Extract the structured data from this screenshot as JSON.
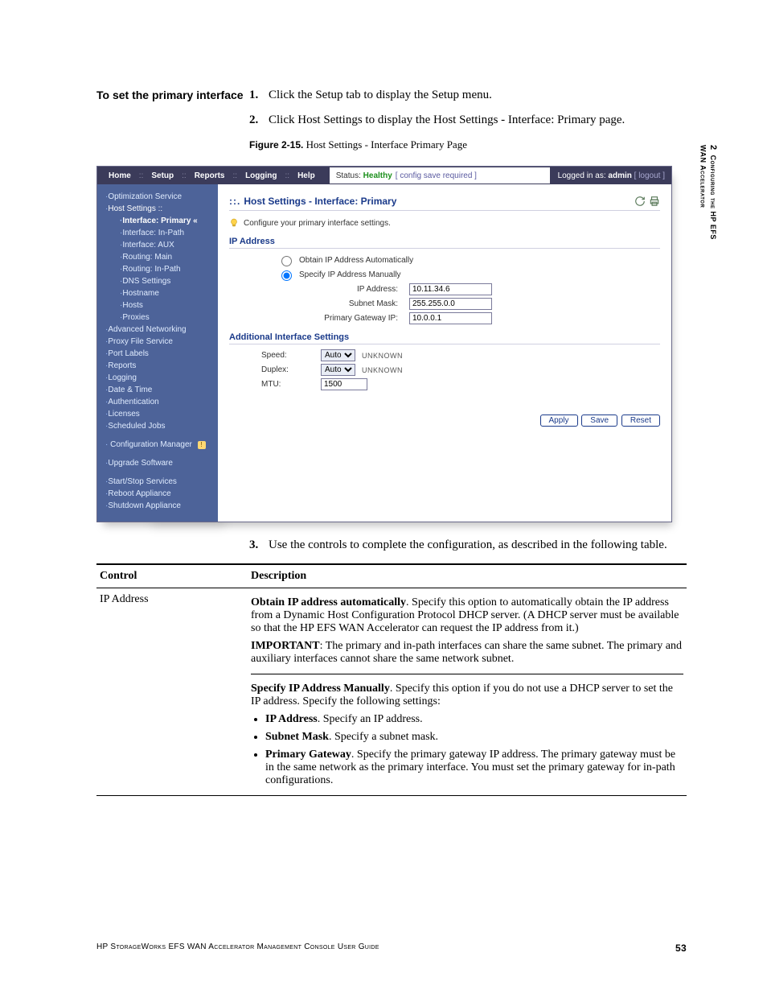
{
  "side": {
    "chapnum": "2",
    "chaptext_l1": "Configuring the HP EFS",
    "chaptext_l2": "WAN Accelerator"
  },
  "heading_left": "To set the primary interface",
  "steps": {
    "s1": "Click the Setup tab to display the Setup menu.",
    "s2": "Click Host Settings to display the Host Settings - Interface: Primary page.",
    "s3": "Use the controls to complete the configuration, as described in the following table."
  },
  "fig": {
    "label": "Figure 2-15.",
    "title": "Host Settings - Interface Primary Page"
  },
  "topbar": {
    "tab_home": "Home",
    "tab_setup": "Setup",
    "tab_reports": "Reports",
    "tab_logging": "Logging",
    "tab_help": "Help",
    "status_label": "Status:",
    "status_value": "Healthy",
    "status_note": "[ config save required ]",
    "login_prefix": "Logged in as:",
    "login_user": "admin",
    "logout": "[ logout ]"
  },
  "sidebar": {
    "opt_service": "Optimization Service",
    "host_settings": "Host Settings ::",
    "if_primary": "Interface: Primary",
    "if_inpath": "Interface: In-Path",
    "if_aux": "Interface: AUX",
    "rt_main": "Routing: Main",
    "rt_inpath": "Routing: In-Path",
    "dns": "DNS Settings",
    "hostname": "Hostname",
    "hosts": "Hosts",
    "proxies": "Proxies",
    "adv_net": "Advanced Networking",
    "proxy_fs": "Proxy File Service",
    "port_labels": "Port Labels",
    "reports": "Reports",
    "logging": "Logging",
    "datetime": "Date & Time",
    "auth": "Authentication",
    "licenses": "Licenses",
    "sched": "Scheduled Jobs",
    "cfgmgr": "Configuration Manager",
    "upgrade": "Upgrade Software",
    "startstop": "Start/Stop Services",
    "reboot": "Reboot Appliance",
    "shutdown": "Shutdown Appliance"
  },
  "main": {
    "title": "Host Settings - Interface: Primary",
    "hint": "Configure your primary interface settings.",
    "sect_ip": "IP Address",
    "radio_auto": "Obtain IP Address Automatically",
    "radio_manual": "Specify IP Address Manually",
    "lbl_ip": "IP Address:",
    "lbl_subnet": "Subnet Mask:",
    "lbl_gw": "Primary Gateway IP:",
    "val_ip": "10.11.34.6",
    "val_subnet": "255.255.0.0",
    "val_gw": "10.0.0.1",
    "sect_addl": "Additional Interface Settings",
    "lbl_speed": "Speed:",
    "val_speed": "Auto",
    "after_speed": "UNKNOWN",
    "lbl_duplex": "Duplex:",
    "val_duplex": "Auto",
    "after_duplex": "UNKNOWN",
    "lbl_mtu": "MTU:",
    "val_mtu": "1500",
    "btn_apply": "Apply",
    "btn_save": "Save",
    "btn_reset": "Reset"
  },
  "table": {
    "h1": "Control",
    "h2": "Description",
    "row_ctrl": "IP Address",
    "d1a_b": "Obtain IP address automatically",
    "d1a": ". Specify this option to automatically obtain the IP address from a Dynamic Host Configuration Protocol DHCP server. (A DHCP server must be available so that the HP EFS WAN Accelerator can request the IP address from it.)",
    "d1b_b": "IMPORTANT",
    "d1b": ": The primary and in-path interfaces can share the same subnet. The primary and auxiliary interfaces cannot share the same network subnet.",
    "d2_b": "Specify IP Address Manually",
    "d2": ". Specify this option if you do not use a DHCP server to set the IP address. Specify the following settings:",
    "li1_b": "IP Address",
    "li1": ". Specify an IP address.",
    "li2_b": "Subnet Mask",
    "li2": ". Specify a subnet mask.",
    "li3_b": "Primary Gateway",
    "li3": ". Specify the primary gateway IP address. The primary gateway must be in the same network as the primary interface. You must set the primary gateway for in-path configurations."
  },
  "footer": {
    "title": "HP StorageWorks EFS WAN Accelerator Management Console User Guide",
    "page": "53"
  }
}
